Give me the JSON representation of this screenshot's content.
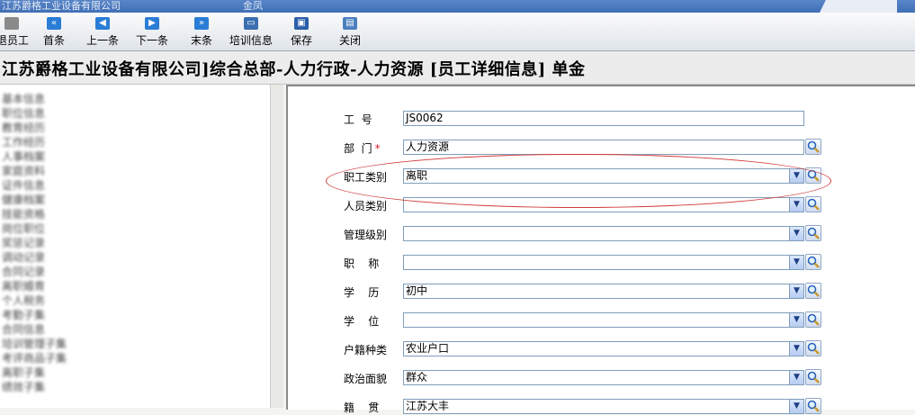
{
  "window": {
    "title": "江苏爵格工业设备有限公司",
    "title_suffix": "金凤"
  },
  "toolbar": {
    "items": [
      {
        "label": "退员工",
        "icon": "person-icon"
      },
      {
        "label": "首条",
        "icon": "first-record-icon"
      },
      {
        "label": "上一条",
        "icon": "previous-record-icon"
      },
      {
        "label": "下一条",
        "icon": "next-record-icon"
      },
      {
        "label": "末条",
        "icon": "last-record-icon"
      },
      {
        "label": "培训信息",
        "icon": "training-icon"
      },
      {
        "label": "保存",
        "icon": "save-icon"
      },
      {
        "label": "关闭",
        "icon": "close-icon"
      }
    ]
  },
  "header": {
    "title": "江苏爵格工业设备有限公司]综合总部-人力行政-人力资源 [员工详细信息]    单金"
  },
  "sidebar": {
    "items": [
      "基本信息",
      "职位信息",
      "教育经历",
      "工作经历",
      "人事档案",
      "家庭资料",
      "证件信息",
      "健康档案",
      "技能资格",
      "岗位职位",
      "奖惩记录",
      "调动记录",
      "合同记录",
      "离职婚育",
      "个人税务",
      "考勤子集",
      "合同信息",
      "培训管理子集",
      "考评商品子集",
      "离职子集",
      "绩效子集"
    ]
  },
  "form": {
    "fields": [
      {
        "label": "工  号",
        "value": "JS0062",
        "type": "text",
        "required": false
      },
      {
        "label": "部  门",
        "value": "人力资源",
        "type": "lookup",
        "required": true
      },
      {
        "label": "职工类别",
        "value": "离职",
        "type": "combo",
        "required": false
      },
      {
        "label": "人员类别",
        "value": "",
        "type": "combo",
        "required": false
      },
      {
        "label": "管理级别",
        "value": "",
        "type": "combo",
        "required": false
      },
      {
        "label": "职    称",
        "value": "",
        "type": "combo",
        "required": false
      },
      {
        "label": "学    历",
        "value": "初中",
        "type": "combo",
        "required": false
      },
      {
        "label": "学    位",
        "value": "",
        "type": "combo",
        "required": false
      },
      {
        "label": "户籍种类",
        "value": "农业户口",
        "type": "combo",
        "required": false
      },
      {
        "label": "政治面貌",
        "value": "群众",
        "type": "combo",
        "required": false
      },
      {
        "label": "籍    贯",
        "value": "江苏大丰",
        "type": "combo",
        "required": false
      }
    ],
    "required_mark": "*"
  },
  "colors": {
    "annotation_circle": "#d23a3a",
    "required": "#d22222"
  }
}
